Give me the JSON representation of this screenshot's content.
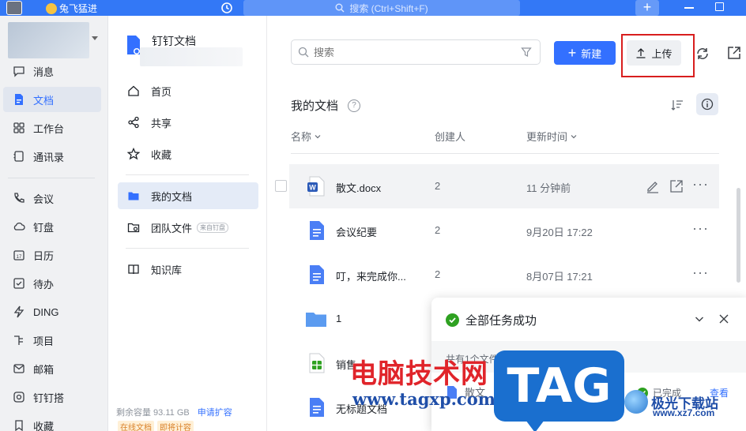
{
  "titlebar": {
    "member_label": "兔飞猛进",
    "search_placeholder": "搜索 (Ctrl+Shift+F)",
    "plus": "+"
  },
  "leftnav": {
    "items": [
      {
        "label": "消息",
        "icon": "message-icon"
      },
      {
        "label": "文档",
        "icon": "doc-icon",
        "active": true
      },
      {
        "label": "工作台",
        "icon": "grid-icon"
      },
      {
        "label": "通讯录",
        "icon": "contacts-icon"
      },
      {
        "label": "会议",
        "icon": "phone-icon"
      },
      {
        "label": "钉盘",
        "icon": "cloud-icon"
      },
      {
        "label": "日历",
        "icon": "calendar-icon"
      },
      {
        "label": "待办",
        "icon": "todo-icon"
      },
      {
        "label": "DING",
        "icon": "ding-icon"
      },
      {
        "label": "项目",
        "icon": "project-icon"
      },
      {
        "label": "邮箱",
        "icon": "mail-icon"
      },
      {
        "label": "钉钉搭",
        "icon": "builder-icon"
      },
      {
        "label": "收藏",
        "icon": "bookmark-icon"
      }
    ]
  },
  "docsnav": {
    "app_name": "钉钉文档",
    "items": [
      {
        "label": "首页",
        "icon": "home-icon"
      },
      {
        "label": "共享",
        "icon": "share-icon"
      },
      {
        "label": "收藏",
        "icon": "star-icon"
      },
      {
        "label": "我的文档",
        "icon": "folder-icon",
        "active": true
      },
      {
        "label": "团队文件",
        "icon": "team-folder-icon",
        "badge": "来自钉盘"
      },
      {
        "label": "知识库",
        "icon": "book-icon"
      }
    ],
    "capacity": "剩余容量 93.11 GB",
    "expand": "申请扩容",
    "tag_online": "在线文档",
    "tag_billing": "即将计容"
  },
  "main": {
    "search_placeholder": "搜索",
    "new_button": "新建",
    "upload_button": "上传",
    "section_title": "我的文档",
    "columns": {
      "name": "名称",
      "creator": "创建人",
      "updated": "更新时间"
    },
    "rows": [
      {
        "name": "散文.docx",
        "creator": "2",
        "updated": "11 分钟前",
        "type": "word"
      },
      {
        "name": "会议纪要",
        "creator": "2",
        "updated": "9月20日 17:22",
        "type": "doc"
      },
      {
        "name": "叮，来完成你...",
        "creator": "2",
        "updated": "8月07日 17:21",
        "type": "doc"
      },
      {
        "name": "1",
        "creator": "",
        "updated": "",
        "type": "folder"
      },
      {
        "name": "销售",
        "creator": "",
        "updated": "",
        "type": "sheet"
      },
      {
        "name": "无标题文档",
        "creator": "",
        "updated": "",
        "type": "doc"
      }
    ]
  },
  "toast": {
    "title": "全部任务成功",
    "summary": "共有1个文件 · 已完成1个 · 失败0个",
    "item_name": "散文",
    "item_status": "已完成",
    "view_label": "查看"
  },
  "watermark": {
    "cn_text": "电脑技术网",
    "url": "www.tagxp.com",
    "tag": "TAG",
    "site_name": "极光下载站",
    "site_url": "www.xz7.com"
  },
  "colors": {
    "brand": "#3370ff",
    "titlebar": "#3378f6",
    "highlight": "#d81e1e",
    "success": "#2ea121"
  }
}
